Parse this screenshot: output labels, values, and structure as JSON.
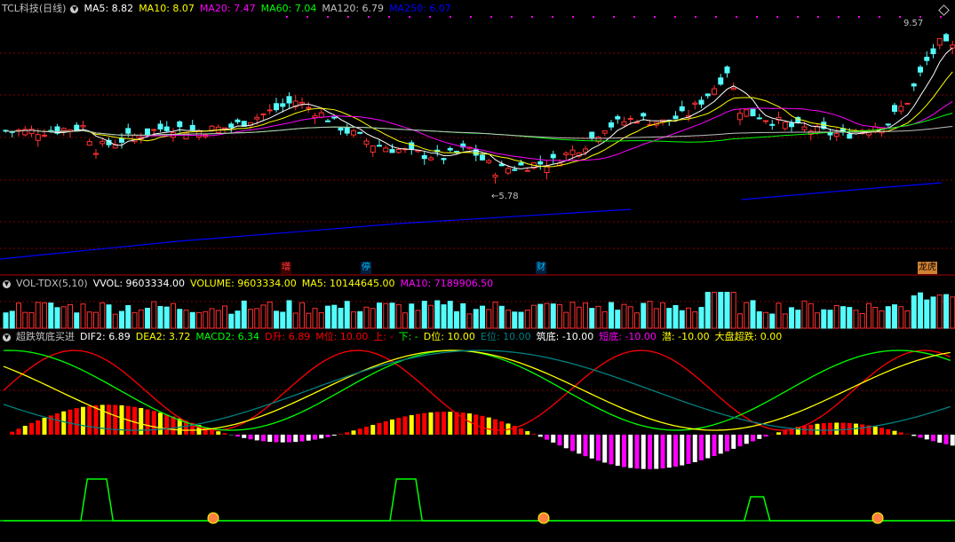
{
  "price_panel": {
    "title": "TCL科技(日线)",
    "ma_labels": [
      {
        "text": "MA5: 8.82",
        "color": "#ffffff"
      },
      {
        "text": "MA10: 8.07",
        "color": "#ffff00"
      },
      {
        "text": "MA20: 7.47",
        "color": "#ff00ff"
      },
      {
        "text": "MA60: 7.04",
        "color": "#00ff00"
      },
      {
        "text": "MA120: 6.79",
        "color": "#c0c0c0"
      },
      {
        "text": "MA250: 6.07",
        "color": "#0000ff"
      }
    ],
    "high_label": "9.57",
    "low_label": "5.78",
    "event_tags": [
      {
        "text": "增",
        "color": "#ff4040",
        "bg": "#400000"
      },
      {
        "text": "停",
        "color": "#00c0ff",
        "bg": "#002040"
      },
      {
        "text": "财",
        "color": "#00c0ff",
        "bg": "#002040"
      },
      {
        "text": "龙虎",
        "color": "#000000",
        "bg": "#d08030"
      }
    ]
  },
  "volume_panel": {
    "title": "VOL-TDX(5,10)",
    "labels": [
      {
        "text": "VVOL: 9603334.00",
        "color": "#ffffff"
      },
      {
        "text": "VOLUME: 9603334.00",
        "color": "#ffff00"
      },
      {
        "text": "MA5: 10144645.00",
        "color": "#ffff00"
      },
      {
        "text": "MA10: 7189906.50",
        "color": "#ff00ff"
      }
    ]
  },
  "indicator_panel": {
    "title": "超跌筑底买进",
    "labels": [
      {
        "text": "DIF2: 6.89",
        "color": "#ffffff"
      },
      {
        "text": "DEA2: 3.72",
        "color": "#ffff00"
      },
      {
        "text": "MACD2: 6.34",
        "color": "#00ff00"
      },
      {
        "text": "D升: 6.89",
        "color": "#ff0000"
      },
      {
        "text": "M位: 10.00",
        "color": "#ff0000"
      },
      {
        "text": "上: -",
        "color": "#ff0000"
      },
      {
        "text": "下: -",
        "color": "#00ff00"
      },
      {
        "text": "D位: 10.00",
        "color": "#ffff00"
      },
      {
        "text": "E位: 10.00",
        "color": "#008080"
      },
      {
        "text": "筑底: -10.00",
        "color": "#ffffff"
      },
      {
        "text": "短底: -10.00",
        "color": "#ff00ff"
      },
      {
        "text": "潜: -10.00",
        "color": "#ffff00"
      },
      {
        "text": "大盘超跌: 0.00",
        "color": "#ffff00"
      }
    ]
  },
  "chart_data": [
    {
      "type": "candlestick",
      "title": "TCL科技(日线)",
      "ylim": [
        4.5,
        10.2
      ],
      "series": [
        {
          "name": "MA5",
          "value": 8.82
        },
        {
          "name": "MA10",
          "value": 8.07
        },
        {
          "name": "MA20",
          "value": 7.47
        },
        {
          "name": "MA60",
          "value": 7.04
        },
        {
          "name": "MA120",
          "value": 6.79
        },
        {
          "name": "MA250",
          "value": 6.07
        }
      ],
      "annotations": [
        "9.57",
        "5.78"
      ]
    },
    {
      "type": "bar",
      "title": "VOL-TDX(5,10)",
      "series": [
        {
          "name": "VVOL",
          "value": 9603334.0
        },
        {
          "name": "VOLUME",
          "value": 9603334.0
        },
        {
          "name": "MA5",
          "value": 10144645.0
        },
        {
          "name": "MA10",
          "value": 7189906.5
        }
      ]
    },
    {
      "type": "bar",
      "title": "超跌筑底买进",
      "series": [
        {
          "name": "DIF2",
          "value": 6.89
        },
        {
          "name": "DEA2",
          "value": 3.72
        },
        {
          "name": "MACD2",
          "value": 6.34
        }
      ]
    }
  ],
  "colors": {
    "up": "#ff3030",
    "down": "#54fcfc",
    "grid": "#800000",
    "ma5": "#ffffff",
    "ma10": "#ffff00",
    "ma20": "#ff00ff",
    "ma60": "#00ff00",
    "ma120": "#c0c0c0",
    "ma250": "#0000ff"
  }
}
